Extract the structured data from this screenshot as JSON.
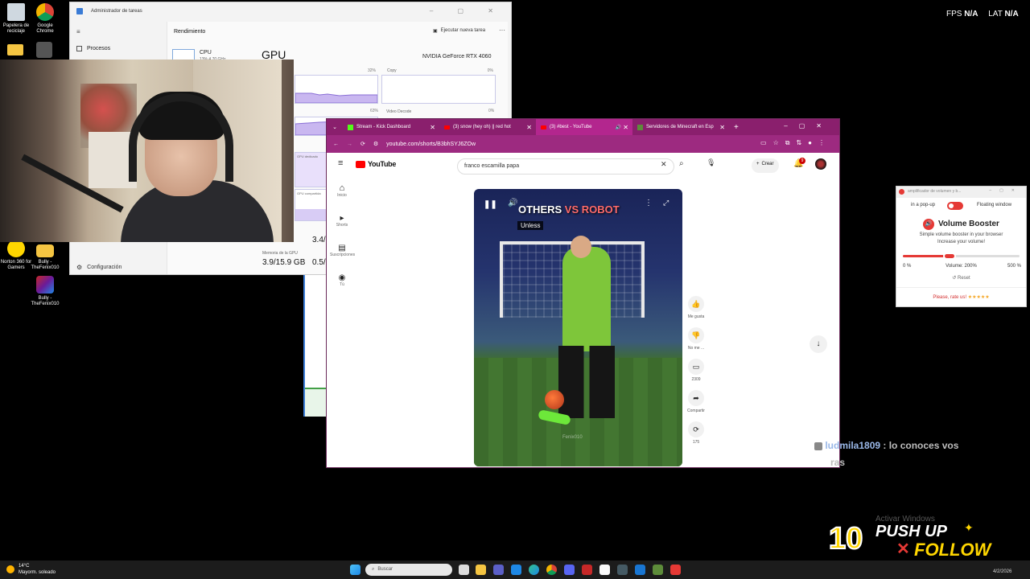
{
  "desktop": {
    "icons": [
      {
        "label": "Papelera de reciclaje",
        "name": "recycle-bin"
      },
      {
        "label": "Google Chrome",
        "name": "chrome"
      },
      {
        "label": "Norton 360 for Gamers",
        "name": "norton"
      },
      {
        "label": "Bully - TheFenix010",
        "name": "bully-folder"
      },
      {
        "label": "Bully - TheFenix010",
        "name": "bully-game"
      }
    ],
    "activate_windows": "Activar Windows"
  },
  "overlay": {
    "fps_label": "FPS",
    "fps_value": "N/A",
    "lat_label": "LAT",
    "lat_value": "N/A",
    "chat_user": "ludmila1809",
    "chat_sep": " : ",
    "chat_message": "lo conoces vos",
    "chat_message_cont": "ras",
    "banner_number": "10",
    "banner_line1": "PUSH UP",
    "banner_line2": "FOLLOW",
    "banner_x": "✕"
  },
  "taskmgr": {
    "title": "Administrador de tareas",
    "nav_processes": "Procesos",
    "nav_settings": "Configuración",
    "heading": "Rendimiento",
    "run_task": "Ejecutar nueva tarea",
    "more": "···",
    "cpu_label": "CPU",
    "cpu_sub": "13%  4.70 GHz",
    "gpu_title": "GPU",
    "gpu_model": "NVIDIA GeForce RTX 4060",
    "graph_3d_pct": "32%",
    "graph_copy": "Copy",
    "graph_copy_pct": "0%",
    "graph_video_decode": "Video Decode",
    "graph_vd_pct": "0%",
    "graph_de_pct": "63%",
    "gpu_dedicated": "GPU dedicado",
    "gpu_shared": "GPU compartida",
    "stat_partial": "3.4/",
    "gpu_mem_label": "Memoria de la GPU",
    "gpu_mem_value": "3.9/15.9 GB",
    "shared_mem_value": "0.5/"
  },
  "browser": {
    "tabs": [
      {
        "title": "Stream - Kick Dashboard",
        "icon": "kick-icon"
      },
      {
        "title": "(3) snow (hey oh) || red hot",
        "icon": "youtube-icon"
      },
      {
        "title": "(3) #best - YouTube",
        "icon": "youtube-icon"
      },
      {
        "title": "Servidores de Minecraft en Esp",
        "icon": "minecraft-icon"
      }
    ],
    "url": "youtube.com/shorts/B3bhSYJ6ZOw",
    "youtube": {
      "logo": "YouTube",
      "search_value": "franco escamilla papa",
      "create": "Crear",
      "notif_count": "9",
      "nav": [
        {
          "label": "Inicio",
          "glyph": "⌂"
        },
        {
          "label": "Shorts",
          "glyph": "▸"
        },
        {
          "label": "Suscripciones",
          "glyph": "▤"
        },
        {
          "label": "Tú",
          "glyph": "◉"
        }
      ],
      "video_title_part1": "OTHERS ",
      "video_title_part2": "VS ROBOT",
      "caption": "Unless",
      "channel": "Fenix010",
      "actions": [
        {
          "label": "Me gusta",
          "glyph": "👍"
        },
        {
          "label": "No me ...",
          "glyph": "👎"
        },
        {
          "label": "2309",
          "glyph": "▭"
        },
        {
          "label": "Compartir",
          "glyph": "➦"
        },
        {
          "label": "175",
          "glyph": "⟳"
        }
      ]
    }
  },
  "volume_booster": {
    "window_title": "amplificador de volumen y b...",
    "popup_label": "in a pop-up",
    "floating_label": "Floating window",
    "title": "Volume Booster",
    "subtitle_1": "Simple volume booster in your browser",
    "subtitle_2": "Increase your volume!",
    "min_label": "0 %",
    "volume_text": "Volume: 200%",
    "max_label": "500 %",
    "volume_value": 200,
    "volume_max": 500,
    "reset": "Reset",
    "rate": "Please, rate us!",
    "stars": "★★★★★"
  },
  "taskbar": {
    "temp": "14°C",
    "weather": "Mayorm. soleado",
    "search_placeholder": "Buscar",
    "date": "4/2/2026"
  }
}
